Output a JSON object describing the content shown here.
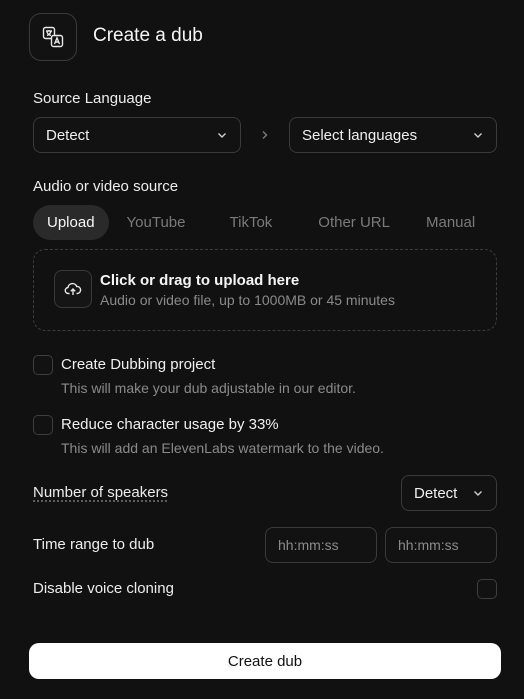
{
  "header": {
    "title": "Create a dub"
  },
  "source_language": {
    "label": "Source Language",
    "selected": "Detect"
  },
  "target_language": {
    "placeholder": "Select languages"
  },
  "source": {
    "label": "Audio or video source",
    "tabs": [
      {
        "label": "Upload",
        "active": true
      },
      {
        "label": "YouTube",
        "active": false
      },
      {
        "label": "TikTok",
        "active": false
      },
      {
        "label": "Other URL",
        "active": false
      },
      {
        "label": "Manual",
        "active": false
      }
    ],
    "dropzone": {
      "title": "Click or drag to upload here",
      "subtitle": "Audio or video file, up to 1000MB or 45 minutes"
    }
  },
  "options": {
    "dubbing_project": {
      "title": "Create Dubbing project",
      "description": "This will make your dub adjustable in our editor.",
      "checked": false
    },
    "reduce_usage": {
      "title": "Reduce character usage by 33%",
      "description": "This will add an ElevenLabs watermark to the video.",
      "checked": false
    }
  },
  "speakers": {
    "label": "Number of speakers",
    "selected": "Detect"
  },
  "time_range": {
    "label": "Time range to dub",
    "start_placeholder": "hh:mm:ss",
    "end_placeholder": "hh:mm:ss"
  },
  "voice_cloning": {
    "label": "Disable voice cloning",
    "checked": false
  },
  "submit": {
    "label": "Create dub"
  },
  "colors": {
    "background": "#111111",
    "border": "#3a3a3a",
    "primary_button": "#ffffff",
    "muted_text": "#8a8a8a"
  }
}
